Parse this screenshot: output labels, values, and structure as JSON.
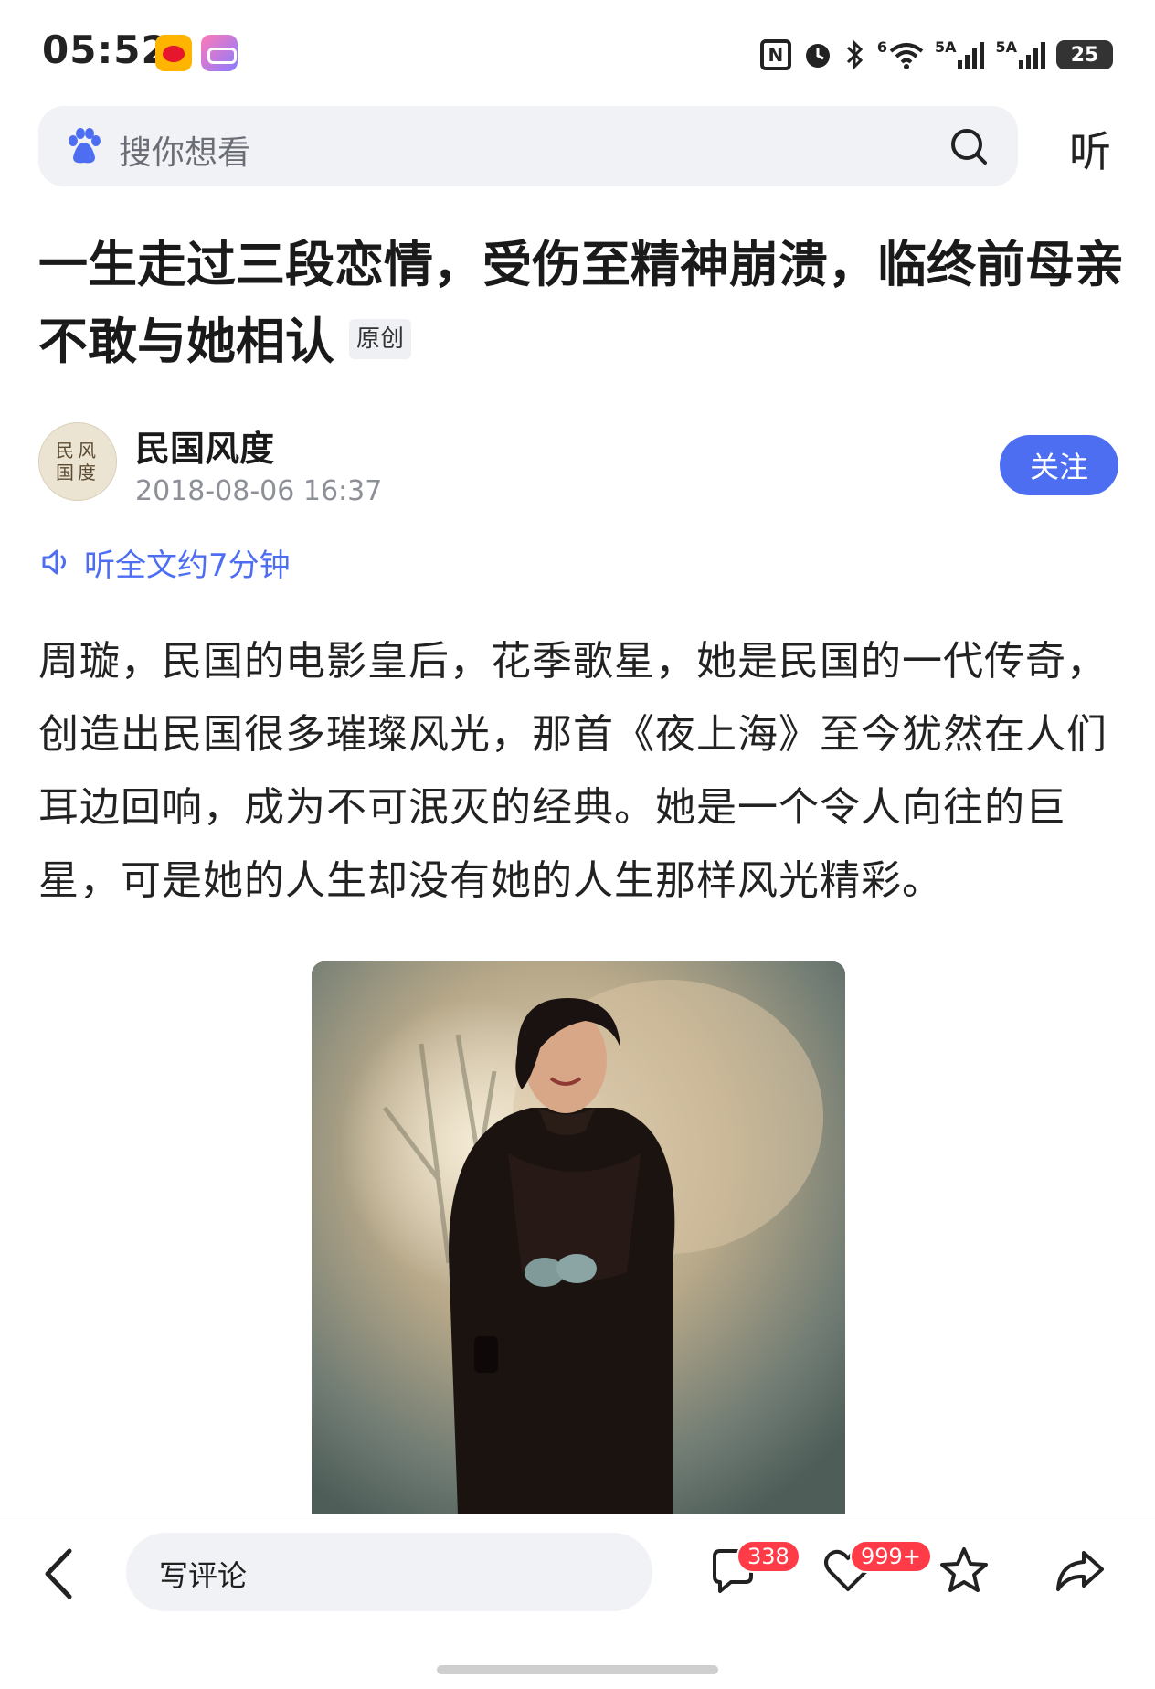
{
  "status_bar": {
    "time": "05:52",
    "app_icons": [
      "weibo-icon",
      "glasses-app-icon"
    ],
    "indicators": [
      "nfc-icon",
      "alarm-icon",
      "bluetooth-icon",
      "wifi-icon",
      "signal-icon",
      "signal-icon"
    ],
    "wifi_label": "6",
    "signal1_label": "5A",
    "signal2_label": "5A",
    "battery_level": "25"
  },
  "search": {
    "placeholder": "搜你想看",
    "logo_icon": "baidu-paw-icon",
    "search_icon": "search-icon",
    "listen_label": "听"
  },
  "article": {
    "title": "一生走过三段恋情，受伤至精神崩溃，临终前母亲不敢与她相认",
    "original_badge": "原创",
    "author": {
      "name": "民国风度",
      "avatar_text": "民风国度",
      "publish_time": "2018-08-06 16:37",
      "follow_label": "关注"
    },
    "listen_full": "听全文约7分钟",
    "paragraph": "周璇，民国的电影皇后，花季歌星，她是民国的一代传奇，创造出民国很多璀璨风光，那首《夜上海》至今犹然在人们耳边回响，成为不可泯灭的经典。她是一个令人向往的巨星，可是她的人生却没有她的人生那样风光精彩。"
  },
  "bottom_bar": {
    "back_icon": "back-arrow-icon",
    "comment_placeholder": "写评论",
    "comment_count": "338",
    "like_count": "999+",
    "icons": [
      "comment-icon",
      "heart-icon",
      "star-icon",
      "share-icon"
    ]
  },
  "colors": {
    "accent": "#4e6ef2",
    "badge_red": "#ff3b47",
    "search_bg": "#f1f2f5"
  }
}
